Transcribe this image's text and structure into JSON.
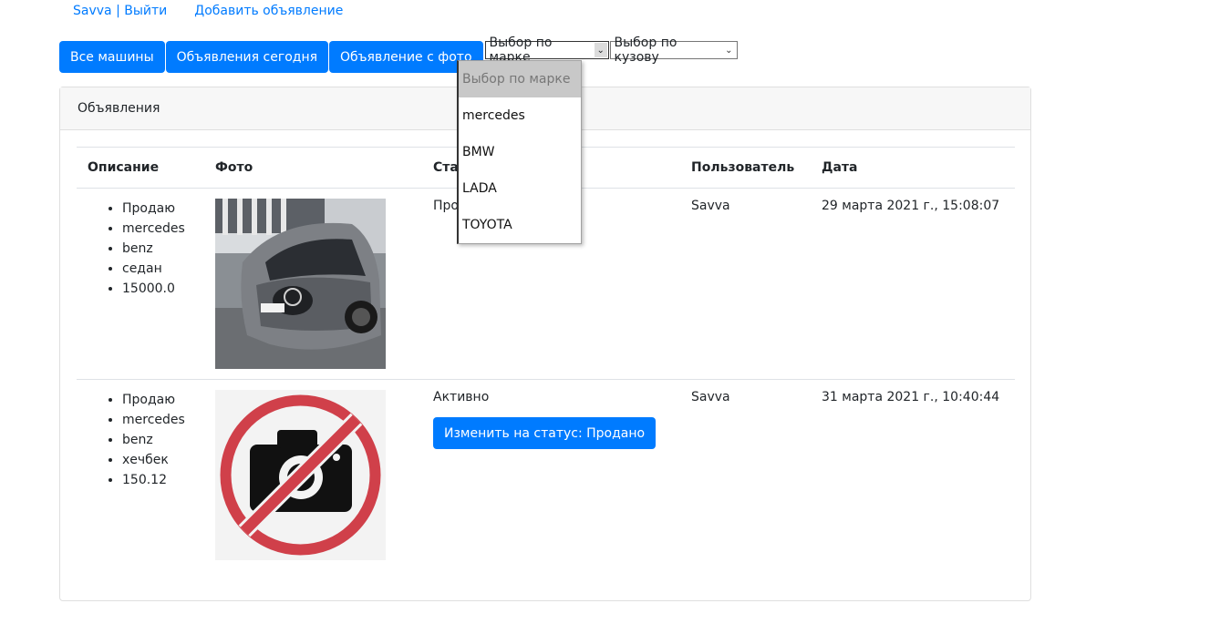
{
  "topnav": {
    "user_link": "Savva | Выйти",
    "add_link": "Добавить объявление"
  },
  "toolbar": {
    "all_cars": "Все машины",
    "today": "Объявления сегодня",
    "with_photo": "Объявление с фото",
    "brand_select": "Выбор по марке",
    "body_select": "Выбор по кузову"
  },
  "brand_dropdown": {
    "options": [
      "Выбор по марке",
      "mercedes",
      "BMW",
      "LADA",
      "TOYOTA"
    ]
  },
  "card": {
    "header": "Объявления",
    "columns": [
      "Описание",
      "Фото",
      "Статус",
      "Пользователь",
      "Дата"
    ],
    "rows": [
      {
        "description": [
          "Продаю",
          "mercedes",
          "benz",
          "седан",
          "15000.0"
        ],
        "photo": "car-photo",
        "status": "Продано",
        "user": "Savva",
        "date": "29 марта 2021 г., 15:08:07"
      },
      {
        "description": [
          "Продаю",
          "mercedes",
          "benz",
          "хечбек",
          "150.12"
        ],
        "photo": "no-photo-icon",
        "status": "Активно",
        "status_button": "Изменить на статус: Продано",
        "user": "Savva",
        "date": "31 марта 2021 г., 10:40:44"
      }
    ]
  },
  "colors": {
    "primary": "#007bff",
    "no_photo_red": "#d0404a"
  }
}
